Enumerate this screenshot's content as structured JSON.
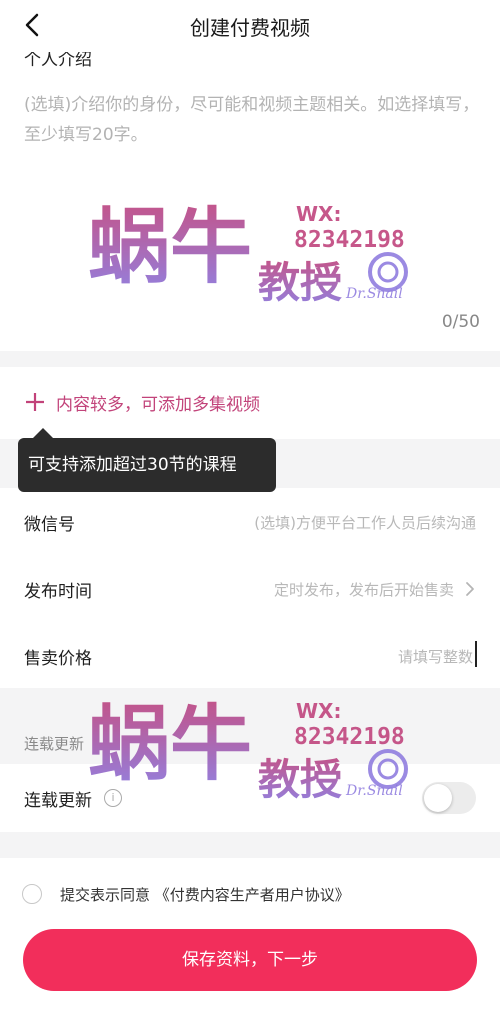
{
  "header": {
    "title": "创建付费视频"
  },
  "intro": {
    "label": "个人介绍",
    "placeholder": "(选填)介绍你的身份，尽可能和视频主题相关。如选择填写，至少填写20字。",
    "counter": "0/50"
  },
  "watermark": {
    "brand_top": "蜗牛",
    "brand_bottom": "教授",
    "wx_label": "WX:",
    "wx_number": "82342198",
    "signature": "Dr.Snail",
    "colors": {
      "pink": "#c0457e",
      "purple": "#8a76dd"
    }
  },
  "add_episodes": {
    "label": "内容较多，可添加多集视频"
  },
  "tooltip": {
    "text": "可支持添加超过30节的课程"
  },
  "form": {
    "wechat": {
      "label": "微信号",
      "placeholder": "(选填)方便平台工作人员后续沟通"
    },
    "publish_time": {
      "label": "发布时间",
      "value": "定时发布，发布后开始售卖"
    },
    "price": {
      "label": "售卖价格",
      "placeholder": "请填写整数"
    }
  },
  "serial": {
    "section_label": "连载更新",
    "toggle_label": "连载更新",
    "toggle_on": false
  },
  "agreement": {
    "prefix": "提交表示同意",
    "link": "《付费内容生产者用户协议》"
  },
  "submit": {
    "label": "保存资料，下一步"
  },
  "colors": {
    "accent": "#f22e5b",
    "link_pink": "#c2437a"
  }
}
